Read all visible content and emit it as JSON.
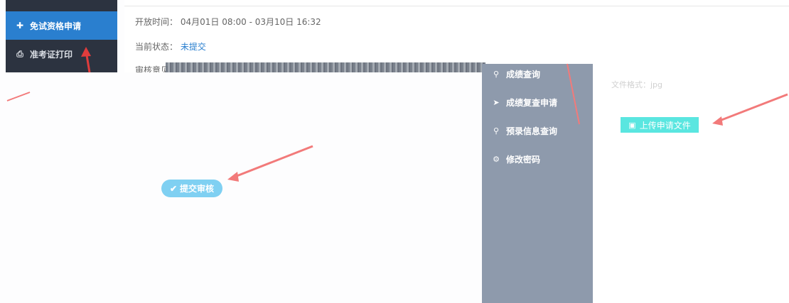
{
  "top_sidebar": {
    "items": [
      {
        "label": "免试资格申请",
        "icon": "plus-icon",
        "active": true
      },
      {
        "label": "准考证打印",
        "icon": "printer-icon",
        "active": false
      }
    ]
  },
  "info": {
    "open_time_label": "开放时间：",
    "open_time_value": "04月01日 08:00 - 03月10日 16:32",
    "status_label": "当前状态：",
    "status_value": "未提交",
    "review_label": "审核意见"
  },
  "submit_button": {
    "label": "提交审核",
    "icon": "check-icon"
  },
  "mid_sidebar": {
    "items": [
      {
        "label": "成绩查询",
        "icon": "search-icon"
      },
      {
        "label": "成绩复查申请",
        "icon": "send-icon"
      },
      {
        "label": "预录信息查询",
        "icon": "search-icon"
      },
      {
        "label": "修改密码",
        "icon": "gear-icon"
      }
    ]
  },
  "upload": {
    "file_type_text": "文件格式：jpg",
    "button_label": "上传申请文件",
    "icon": "image-icon"
  },
  "colors": {
    "sidebar_dark": "#2c3340",
    "sidebar_active": "#2a7fcf",
    "submit_button": "#7fd0f2",
    "upload_button": "#5ae6e0",
    "arrow": "#f27a7a",
    "mid_sidebar": "#8e9aac"
  }
}
